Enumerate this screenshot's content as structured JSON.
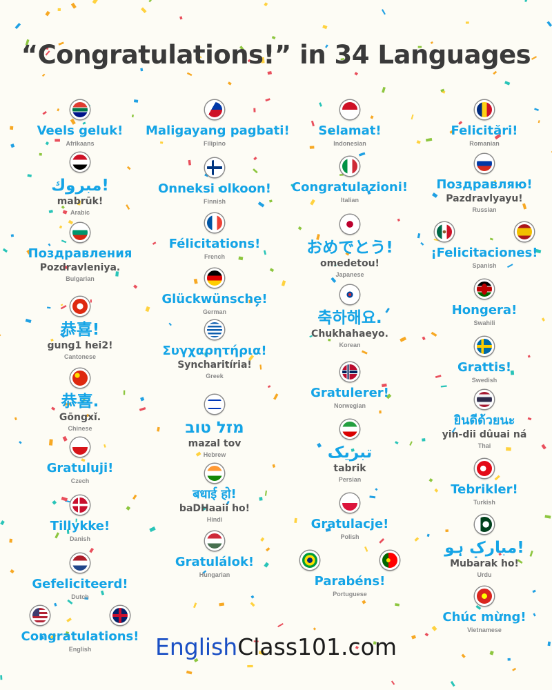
{
  "title": "“Congratulations!” in 34 Languages",
  "footer": {
    "part1": "English",
    "part2": "Class101.com"
  },
  "entries": [
    {
      "greeting": "Veels geluk!",
      "romanization": "",
      "language": "Afrikaans",
      "flags": [
        "za"
      ]
    },
    {
      "greeting": "مبروك!",
      "romanization": "mabrūk!",
      "language": "Arabic",
      "flags": [
        "eg"
      ]
    },
    {
      "greeting": "Поздравления",
      "romanization": "Pozdravleniya.",
      "language": "Bulgarian",
      "flags": [
        "bg"
      ]
    },
    {
      "greeting": "恭喜!",
      "romanization": "gung1 hei2!",
      "language": "Cantonese",
      "flags": [
        "hk"
      ]
    },
    {
      "greeting": "恭喜.",
      "romanization": "Gōngxǐ.",
      "language": "Chinese",
      "flags": [
        "cn"
      ]
    },
    {
      "greeting": "Gratuluji!",
      "romanization": "",
      "language": "Czech",
      "flags": [
        "cz"
      ]
    },
    {
      "greeting": "Tillykke!",
      "romanization": "",
      "language": "Danish",
      "flags": [
        "dk"
      ]
    },
    {
      "greeting": "Gefeliciteerd!",
      "romanization": "",
      "language": "Dutch",
      "flags": [
        "nl"
      ]
    },
    {
      "greeting": "Congratulations!",
      "romanization": "",
      "language": "English",
      "flags": [
        "us",
        "gb"
      ]
    },
    {
      "greeting": "Maligayang pagbati!",
      "romanization": "",
      "language": "Filipino",
      "flags": [
        "ph"
      ]
    },
    {
      "greeting": "Onneksi olkoon!",
      "romanization": "",
      "language": "Finnish",
      "flags": [
        "fi"
      ]
    },
    {
      "greeting": "Félicitations!",
      "romanization": "",
      "language": "French",
      "flags": [
        "fr"
      ]
    },
    {
      "greeting": "Glückwünsche!",
      "romanization": "",
      "language": "German",
      "flags": [
        "de"
      ]
    },
    {
      "greeting": "Συγχαρητήρια!",
      "romanization": "Syncharitíria!",
      "language": "Greek",
      "flags": [
        "gr"
      ]
    },
    {
      "greeting": "מזל טוב",
      "romanization": "mazal tov",
      "language": "Hebrew",
      "flags": [
        "il"
      ]
    },
    {
      "greeting": "बधाई हो!",
      "romanization": "baDHaaii ho!",
      "language": "Hindi",
      "flags": [
        "in"
      ]
    },
    {
      "greeting": "Gratulálok!",
      "romanization": "",
      "language": "Hungarian",
      "flags": [
        "hu"
      ]
    },
    {
      "greeting": "Selamat!",
      "romanization": "",
      "language": "Indonesian",
      "flags": [
        "id"
      ]
    },
    {
      "greeting": "Congratulazioni!",
      "romanization": "",
      "language": "Italian",
      "flags": [
        "it"
      ]
    },
    {
      "greeting": "おめでとう!",
      "romanization": "omedetou!",
      "language": "Japanese",
      "flags": [
        "jp"
      ]
    },
    {
      "greeting": "축하해요.",
      "romanization": "Chukhahaeyo.",
      "language": "Korean",
      "flags": [
        "kr"
      ]
    },
    {
      "greeting": "Gratulerer!",
      "romanization": "",
      "language": "Norwegian",
      "flags": [
        "no"
      ]
    },
    {
      "greeting": "تبریک",
      "romanization": "tabrik",
      "language": "Persian",
      "flags": [
        "ir"
      ]
    },
    {
      "greeting": "Gratulacje!",
      "romanization": "",
      "language": "Polish",
      "flags": [
        "pl"
      ]
    },
    {
      "greeting": "Parabéns!",
      "romanization": "",
      "language": "Portuguese",
      "flags": [
        "br",
        "pt"
      ]
    },
    {
      "greeting": "Felicitări!",
      "romanization": "",
      "language": "Romanian",
      "flags": [
        "ro"
      ]
    },
    {
      "greeting": "Поздравляю!",
      "romanization": "Pazdravlyayu!",
      "language": "Russian",
      "flags": [
        "ru"
      ]
    },
    {
      "greeting": "¡Felicitaciones!",
      "romanization": "",
      "language": "Spanish",
      "flags": [
        "mx",
        "es"
      ]
    },
    {
      "greeting": "Hongera!",
      "romanization": "",
      "language": "Swahili",
      "flags": [
        "ke"
      ]
    },
    {
      "greeting": "Grattis!",
      "romanization": "",
      "language": "Swedish",
      "flags": [
        "se"
      ]
    },
    {
      "greeting": "ยินดีด้วยนะ",
      "romanization": "yin-dii dûuai ná",
      "language": "Thai",
      "flags": [
        "th"
      ]
    },
    {
      "greeting": "Tebrikler!",
      "romanization": "",
      "language": "Turkish",
      "flags": [
        "tr"
      ]
    },
    {
      "greeting": "مبارک ہو!",
      "romanization": "Mubarak ho!",
      "language": "Urdu",
      "flags": [
        "pk"
      ]
    },
    {
      "greeting": "Chúc mừng!",
      "romanization": "",
      "language": "Vietnamese",
      "flags": [
        "vn"
      ]
    }
  ],
  "colors": {
    "greeting": "#14a4e6",
    "romanization": "#555555",
    "language": "#8a8a8a",
    "title": "#3a3a3a",
    "footer_brand": "#1a4fc4"
  }
}
